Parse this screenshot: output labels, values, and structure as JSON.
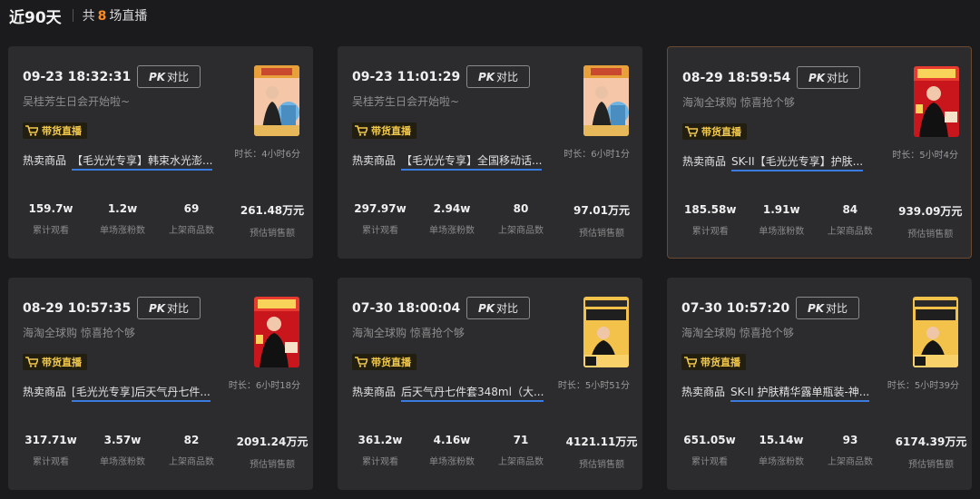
{
  "header": {
    "period": "近90天",
    "total_prefix": "共",
    "count": "8",
    "total_suffix": "场直播"
  },
  "pk_label": "对比",
  "pk_logo": "PK",
  "badge_label": "带货直播",
  "product_label": "热卖商品",
  "stat_labels": [
    "累计观看",
    "单场涨粉数",
    "上架商品数",
    "预估销售额"
  ],
  "colors": {
    "accent_orange": "#ff8a1f",
    "badge_yellow": "#f2c94c",
    "underline_blue": "#3a7be0"
  },
  "cards": [
    {
      "time": "09-23 18:32:31",
      "subtitle": "吴桂芳生日会开始啦~",
      "duration": "时长：4小时6分",
      "product": "【毛光光专享】韩束水光澎...",
      "stats": [
        "159.7w",
        "1.2w",
        "69",
        "261.48万元"
      ],
      "cover": "birthday"
    },
    {
      "time": "09-23 11:01:29",
      "subtitle": "吴桂芳生日会开始啦~",
      "duration": "时长：6小时1分",
      "product": "【毛光光专享】全国移动话...",
      "stats": [
        "297.97w",
        "2.94w",
        "80",
        "97.01万元"
      ],
      "cover": "birthday"
    },
    {
      "time": "08-29 18:59:54",
      "subtitle": "海淘全球购 惊喜抢个够",
      "duration": "时长：5小时4分",
      "product": "SK-II【毛光光专享】护肤...",
      "stats": [
        "185.58w",
        "1.91w",
        "84",
        "939.09万元"
      ],
      "cover": "global"
    },
    {
      "time": "08-29 10:57:35",
      "subtitle": "海淘全球购 惊喜抢个够",
      "duration": "时长：6小时18分",
      "product": "[毛光光专享]后天气丹七件...",
      "stats": [
        "317.71w",
        "3.57w",
        "82",
        "2091.24万元"
      ],
      "cover": "global"
    },
    {
      "time": "07-30 18:00:04",
      "subtitle": "海淘全球购 惊喜抢个够",
      "duration": "时长：5小时51分",
      "product": "后天气丹七件套348ml（大...",
      "stats": [
        "361.2w",
        "4.16w",
        "71",
        "4121.11万元"
      ],
      "cover": "july"
    },
    {
      "time": "07-30 10:57:20",
      "subtitle": "海淘全球购 惊喜抢个够",
      "duration": "时长：5小时39分",
      "product": "SK-II 护肤精华露单瓶装-神...",
      "stats": [
        "651.05w",
        "15.14w",
        "93",
        "6174.39万元"
      ],
      "cover": "july"
    }
  ]
}
